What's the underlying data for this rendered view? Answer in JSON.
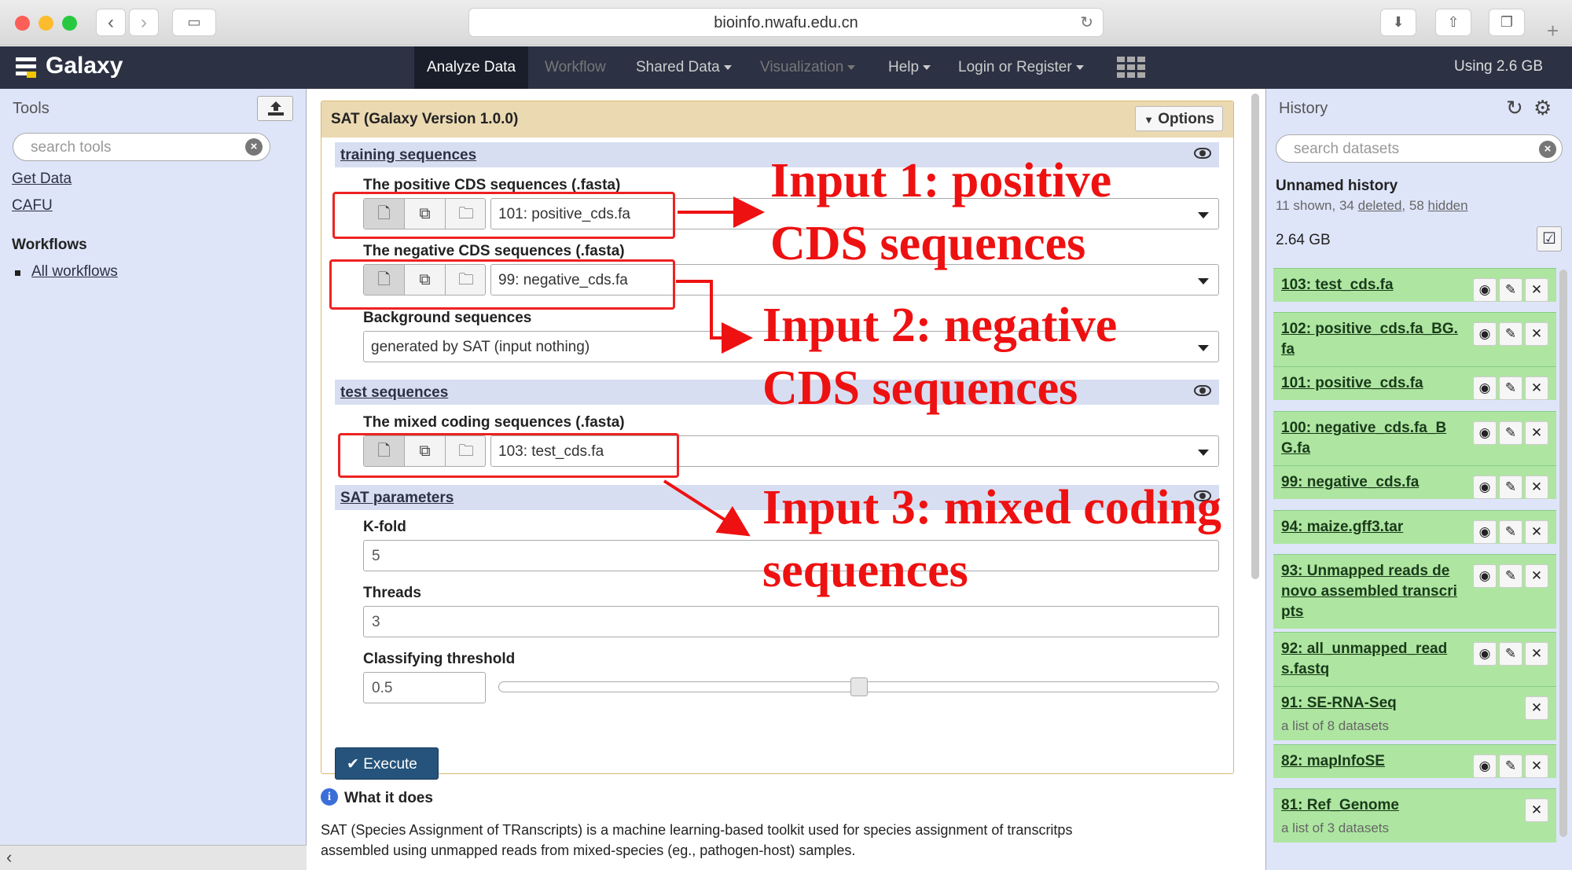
{
  "browser": {
    "url": "bioinfo.nwafu.edu.cn"
  },
  "masthead": {
    "brand": "Galaxy",
    "nav": {
      "analyze": "Analyze Data",
      "workflow": "Workflow",
      "shared": "Shared Data",
      "visualization": "Visualization",
      "help": "Help",
      "login": "Login or Register"
    },
    "usage": "Using 2.6 GB"
  },
  "tools": {
    "header": "Tools",
    "search_placeholder": "search tools",
    "links": [
      "Get Data",
      "CAFU"
    ],
    "workflows_heading": "Workflows",
    "all_workflows": "All workflows"
  },
  "form": {
    "title": "SAT (Galaxy Version 1.0.0)",
    "options_label": "Options",
    "sections": {
      "training": "training sequences",
      "test": "test sequences",
      "params": "SAT parameters"
    },
    "positive": {
      "label": "The positive CDS sequences (.fasta)",
      "value": "101: positive_cds.fa"
    },
    "negative": {
      "label": "The negative CDS sequences (.fasta)",
      "value": "99: negative_cds.fa"
    },
    "background": {
      "label": "Background sequences",
      "value": "generated by SAT (input nothing)"
    },
    "mixed": {
      "label": "The mixed coding sequences (.fasta)",
      "value": "103: test_cds.fa"
    },
    "kfold": {
      "label": "K-fold",
      "value": "5"
    },
    "threads": {
      "label": "Threads",
      "value": "3"
    },
    "threshold": {
      "label": "Classifying threshold",
      "value": "0.5",
      "slider_fraction": 0.5
    },
    "execute_label": "Execute"
  },
  "help": {
    "heading": "What it does",
    "text1": "SAT (Species Assignment of TRanscripts) is a machine learning-based toolkit used for species assignment of transcritps",
    "text2": "assembled using unmapped reads from mixed-species (eg., pathogen-host) samples."
  },
  "annotations": {
    "a1_line1": "Input 1: positive",
    "a1_line2": "CDS sequences",
    "a2_line1": "Input 2: negative",
    "a2_line2": "CDS sequences",
    "a3_line1": "Input 3: mixed coding",
    "a3_line2": "sequences",
    "color": "#ee1111"
  },
  "history": {
    "header": "History",
    "search_placeholder": "search datasets",
    "name": "Unnamed history",
    "summary_shown": "11 shown,",
    "summary_deleted_n": "34",
    "summary_deleted": "deleted",
    "summary_hidden_n": "58",
    "summary_hidden": "hidden",
    "size": "2.64 GB",
    "items": [
      {
        "title": "103: test_cds.fa"
      },
      {
        "title": "102: positive_cds.fa_BG.fa"
      },
      {
        "title": "101: positive_cds.fa"
      },
      {
        "title": "100: negative_cds.fa_BG.fa"
      },
      {
        "title": "99: negative_cds.fa"
      },
      {
        "title": "94: maize.gff3.tar"
      },
      {
        "title": "93: Unmapped reads de novo assembled transcripts"
      },
      {
        "title": "92: all_unmapped_reads.fastq"
      },
      {
        "title": "91: SE-RNA-Seq",
        "sub": "a list of 8 datasets"
      },
      {
        "title": "82: mapInfoSE"
      },
      {
        "title": "81: Ref_Genome",
        "sub": "a list of 3 datasets"
      }
    ],
    "dataset_color": "#aee6a1"
  }
}
